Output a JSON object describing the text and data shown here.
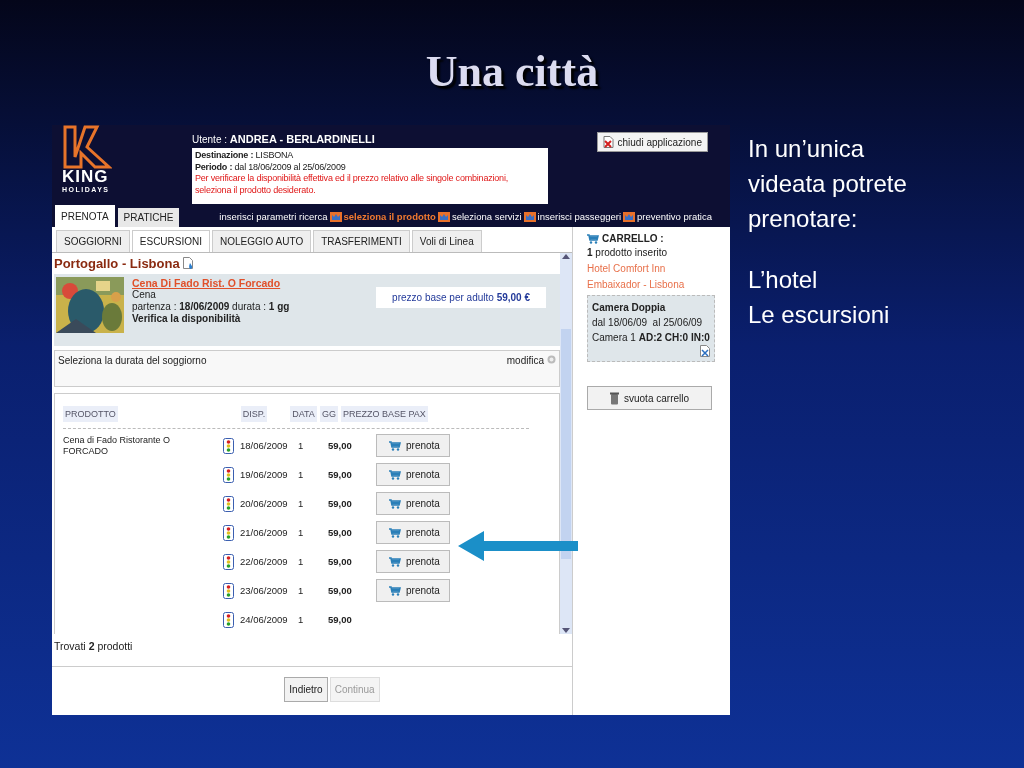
{
  "slide": {
    "title": "Una città",
    "intro": "In un’unica videata potrete prenotare:",
    "items": [
      "L’hotel",
      "Le escursioni"
    ]
  },
  "app": {
    "header": {
      "logo_word": "KING",
      "logo_sub": "HOLIDAYS",
      "user_label": "Utente :",
      "user_name": "ANDREA - BERLARDINELLI",
      "info": {
        "destination_label": "Destinazione :",
        "destination": "LISBONA",
        "period_label": "Periodo :",
        "period": "dal 18/06/2009 al 25/06/2009",
        "warning": "Per verificare la disponibilità effettiva ed il prezzo relativo alle singole combinazioni, seleziona il prodotto desiderato."
      },
      "close_button": "chiudi applicazione"
    },
    "main_tabs": [
      {
        "label": "PRENOTA",
        "selected": true
      },
      {
        "label": "PRATICHE",
        "selected": false
      }
    ],
    "steps": [
      {
        "label": "inserisci parametri ricerca",
        "current": false
      },
      {
        "label": "seleziona il prodotto",
        "current": true
      },
      {
        "label": "seleziona servizi",
        "current": false
      },
      {
        "label": "inserisci passeggeri",
        "current": false
      },
      {
        "label": "preventivo pratica",
        "current": false
      }
    ],
    "sub_tabs": [
      {
        "label": "SOGGIORNI",
        "selected": false
      },
      {
        "label": "ESCURSIONI",
        "selected": true
      },
      {
        "label": "NOLEGGIO AUTO",
        "selected": false
      },
      {
        "label": "TRASFERIMENTI",
        "selected": false
      },
      {
        "label": "Voli di Linea",
        "selected": false
      }
    ],
    "location": "Portogallo - Lisbona",
    "product": {
      "name": "Cena Di Fado Rist. O Forcado",
      "category": "Cena",
      "departure": "partenza : **18/06/2009** durata : **1 gg**",
      "check": "Verifica la disponibilità",
      "price": "prezzo base per adulto **59,00 €**"
    },
    "duration_box": {
      "label": "Seleziona la durata del soggiorno",
      "action": "modifica"
    },
    "table": {
      "columns": [
        "PRODOTTO",
        "DISP.",
        "DATA",
        "GG",
        "PREZZO BASE PAX"
      ],
      "product_name": "Cena di Fado Ristorante O FORCADO",
      "rows": [
        {
          "date": "18/06/2009",
          "days": "1",
          "price": "59,00",
          "button": "prenota"
        },
        {
          "date": "19/06/2009",
          "days": "1",
          "price": "59,00",
          "button": "prenota"
        },
        {
          "date": "20/06/2009",
          "days": "1",
          "price": "59,00",
          "button": "prenota"
        },
        {
          "date": "21/06/2009",
          "days": "1",
          "price": "59,00",
          "button": "prenota"
        },
        {
          "date": "22/06/2009",
          "days": "1",
          "price": "59,00",
          "button": "prenota"
        },
        {
          "date": "23/06/2009",
          "days": "1",
          "price": "59,00",
          "button": "prenota"
        },
        {
          "date": "24/06/2009",
          "days": "1",
          "price": "59,00"
        }
      ]
    },
    "found": "Trovati **2** prodotti",
    "buttons": [
      {
        "label": "Indietro",
        "disabled": false
      },
      {
        "label": "Continua",
        "disabled": true
      }
    ],
    "cart": {
      "title": "CARRELLO :",
      "count": "**1** prodotto inserito",
      "hotel": "Hotel Comfort Inn",
      "hotel_location": "Embaixador - Lisbona",
      "room": "Camera Doppia",
      "dates": "dal 18/06/09  al 25/06/09",
      "occupancy": "Camera 1 **AD:2 CH:0 IN:0**",
      "empty_button": "svuota carrello"
    }
  }
}
